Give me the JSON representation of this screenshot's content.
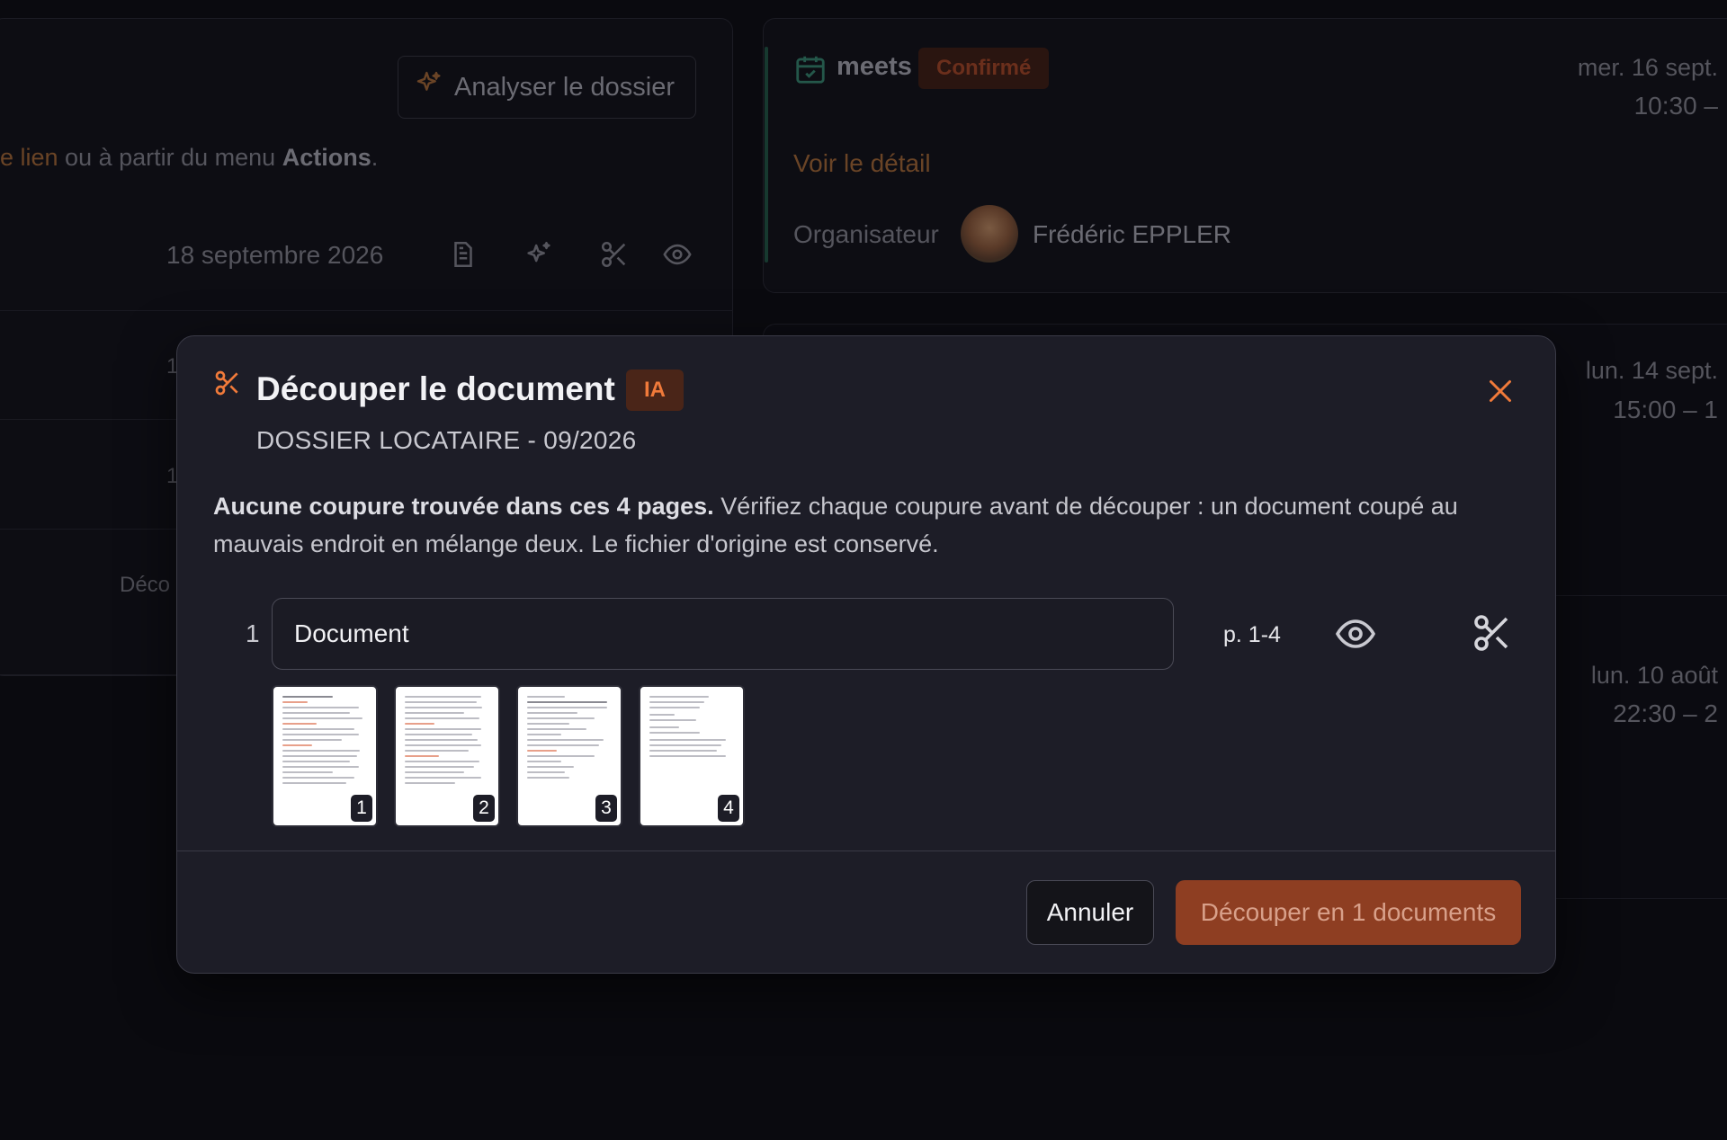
{
  "background": {
    "analyse_button": "Analyser le dossier",
    "help_link": "e lien",
    "help_middle": " ou à partir du menu ",
    "help_bold": "Actions",
    "help_end": ".",
    "row_date": "18 septembre 2026",
    "row_partial_1": "1",
    "row_partial_2": "1",
    "row_partial_3": "Déco",
    "event": {
      "name": "meets",
      "status": "Confirmé",
      "date": "mer. 16 sept.",
      "time": "10:30 –",
      "detail_link": "Voir le détail",
      "organizer_label": "Organisateur",
      "organizer_name": "Frédéric EPPLER"
    },
    "event2": {
      "date": "lun. 14 sept.",
      "time": "15:00 – 1"
    },
    "event3": {
      "date": "lun. 10 août",
      "time": "22:30 – 2"
    }
  },
  "modal": {
    "title": "Découper le document",
    "badge": "IA",
    "subtitle": "DOSSIER LOCATAIRE - 09/2026",
    "desc_bold": "Aucune coupure trouvée dans ces 4 pages.",
    "desc_rest": " Vérifiez chaque coupure avant de découper : un document coupé au mauvais endroit en mélange deux. Le fichier d'origine est conservé.",
    "segment": {
      "index": "1",
      "name_value": "Document",
      "pages_label": "p. 1-4"
    },
    "thumbnails": [
      "1",
      "2",
      "3",
      "4"
    ],
    "cancel_label": "Annuler",
    "submit_label": "Découper en 1 documents"
  }
}
